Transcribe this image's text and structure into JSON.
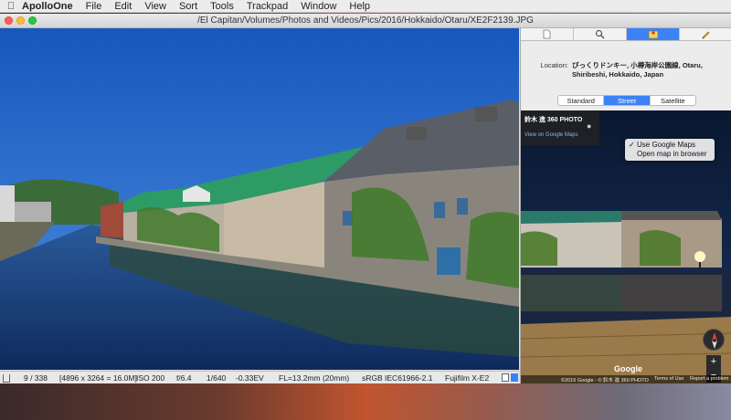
{
  "menubar": {
    "app_name": "ApolloOne",
    "menus": [
      "File",
      "Edit",
      "View",
      "Sort",
      "Tools",
      "Trackpad",
      "Window",
      "Help"
    ]
  },
  "window": {
    "title": "/El Capitan/Volumes/Photos and Videos/Pics/2016/Hokkaido/Otaru/XE2F2139.JPG"
  },
  "status": {
    "index": "9 / 338",
    "dimensions": "[4896 x 3264 = 16.0M]",
    "iso": "ISO 200",
    "aperture": "f/6.4",
    "shutter": "1/640",
    "exposure": "-0.33EV",
    "focal_length": "FL=13.2mm (20mm)",
    "color_space": "sRGB IEC61966-2.1",
    "camera": "Fujifilm X-E2"
  },
  "inspector": {
    "tabs": [
      "file-icon",
      "magnifier-icon",
      "map-icon",
      "pencil-icon"
    ],
    "active_tab": 2,
    "location_label": "Location:",
    "location_value": "びっくりドンキー, 小樽海岸公園線, Otaru, Shiribeshi, Hokkaido, Japan",
    "map_modes": [
      "Standard",
      "Street",
      "Satellite"
    ],
    "selected_mode": "Street"
  },
  "streetview": {
    "title": "鈴木 進 360 PHOTO",
    "link": "View on Google Maps",
    "menu_items": [
      {
        "label": "Use Google Maps",
        "checked": true
      },
      {
        "label": "Open map in browser",
        "checked": false
      }
    ],
    "checkmark": "✓",
    "logo": "Google",
    "zoom_in": "+",
    "zoom_out": "−",
    "attribution": "©2016 Google - © 鈴木 進 360 PHOTO",
    "terms": "Terms of Use",
    "report": "Report a problem"
  },
  "colors": {
    "accent": "#3b82f6",
    "sky": "#1d62c6",
    "water": "#1a3e7a",
    "roof_green": "#2e9a66"
  }
}
